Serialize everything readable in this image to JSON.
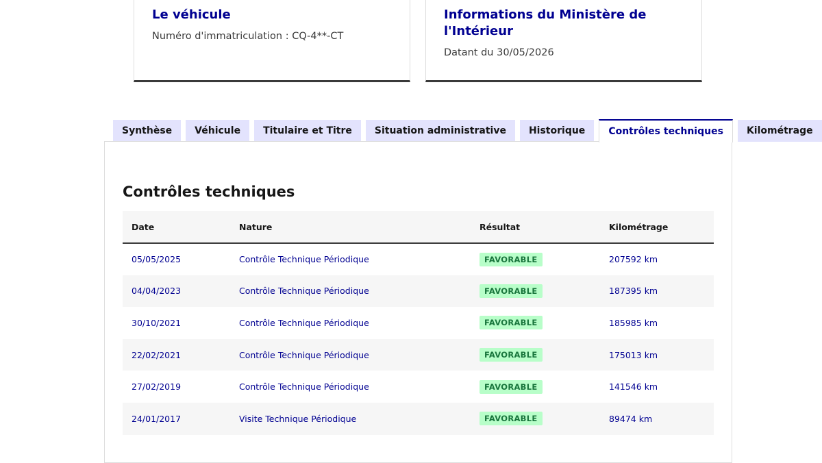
{
  "vehicle_card": {
    "title": "Le véhicule",
    "plate_text": "Numéro d'immatriculation : CQ-4**-CT"
  },
  "ministry_card": {
    "title": "Informations du Ministère de l'Intérieur",
    "date_text": "Datant du 30/05/2026"
  },
  "tabs": [
    {
      "label": "Synthèse",
      "active": false
    },
    {
      "label": "Véhicule",
      "active": false
    },
    {
      "label": "Titulaire et Titre",
      "active": false
    },
    {
      "label": "Situation administrative",
      "active": false
    },
    {
      "label": "Historique",
      "active": false
    },
    {
      "label": "Contrôles techniques",
      "active": true
    },
    {
      "label": "Kilométrage",
      "active": false
    }
  ],
  "panel": {
    "title": "Contrôles techniques",
    "columns": [
      "Date",
      "Nature",
      "Résultat",
      "Kilométrage"
    ],
    "rows": [
      {
        "date": "05/05/2025",
        "nature": "Contrôle Technique Périodique",
        "result": "FAVORABLE",
        "mileage": "207592 km"
      },
      {
        "date": "04/04/2023",
        "nature": "Contrôle Technique Périodique",
        "result": "FAVORABLE",
        "mileage": "187395 km"
      },
      {
        "date": "30/10/2021",
        "nature": "Contrôle Technique Périodique",
        "result": "FAVORABLE",
        "mileage": "185985 km"
      },
      {
        "date": "22/02/2021",
        "nature": "Contrôle Technique Périodique",
        "result": "FAVORABLE",
        "mileage": "175013 km"
      },
      {
        "date": "27/02/2019",
        "nature": "Contrôle Technique Périodique",
        "result": "FAVORABLE",
        "mileage": "141546 km"
      },
      {
        "date": "24/01/2017",
        "nature": "Visite Technique Périodique",
        "result": "FAVORABLE",
        "mileage": "89474 km"
      }
    ]
  },
  "colors": {
    "primary": "#000091",
    "tab_background": "#e3e3fd",
    "success_bg": "#b8fec9",
    "success_text": "#18753c"
  }
}
